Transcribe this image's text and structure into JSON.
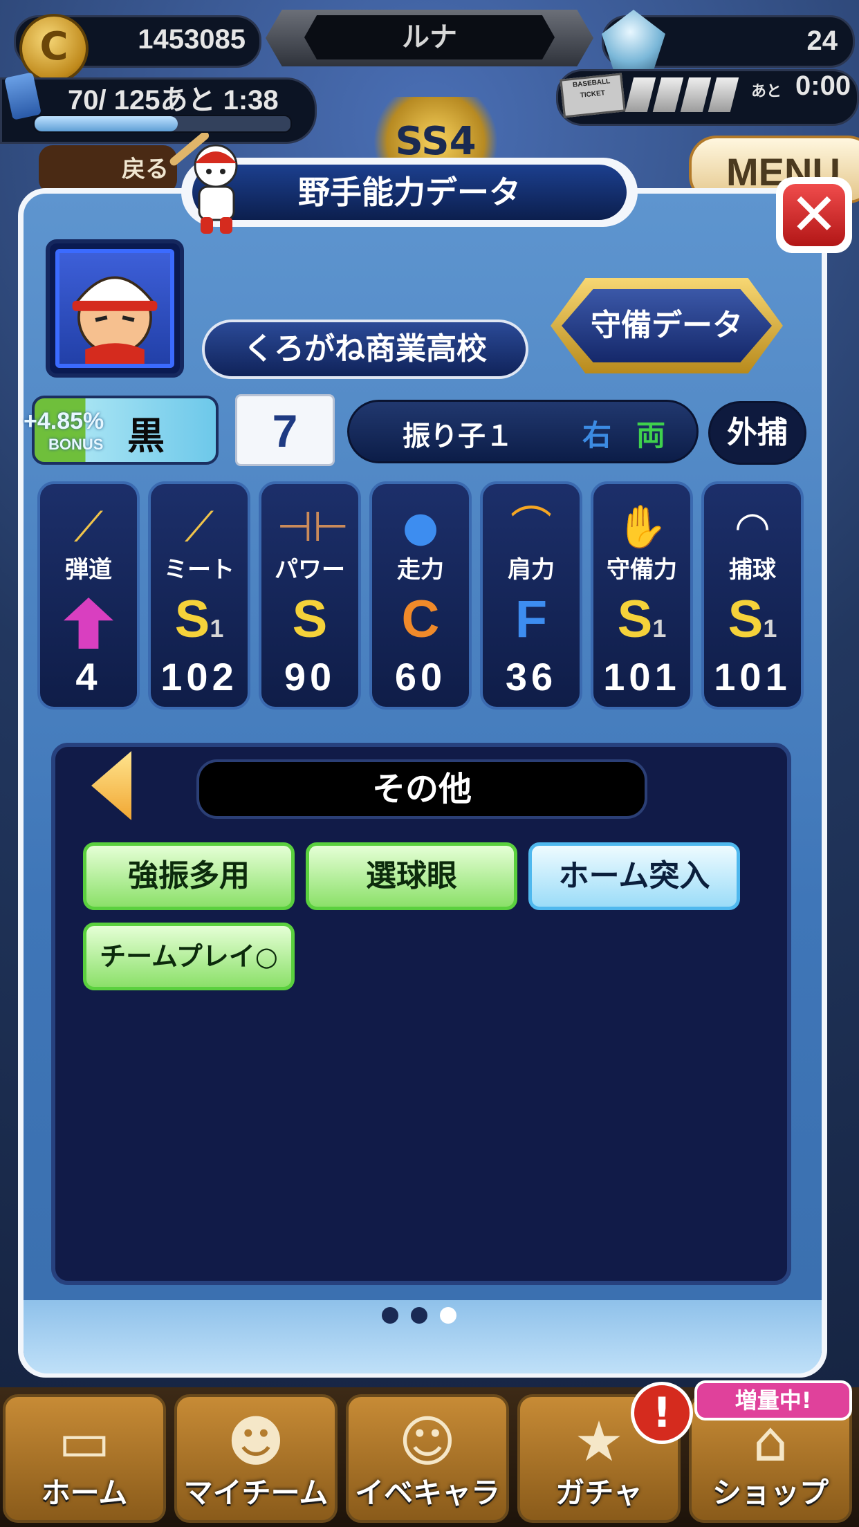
{
  "hud": {
    "coin_symbol": "C",
    "coins": "1453085",
    "player_name": "ルナ",
    "gems": "24",
    "stamina_text": "70/ 125あと  1:38",
    "stamina_fill_fraction": 0.56,
    "ticket_label": "BASEBALL TICKET",
    "ticket_ato": "あと",
    "ticket_time": "0:00",
    "rank_badge": "SS4",
    "back_label": "戻る",
    "menu_label": "MENU"
  },
  "panel": {
    "title": "野手能力データ",
    "close_symbol": "✕",
    "school": "くろがね商業高校",
    "defense_button": "守備データ",
    "bonus_percent": "+4.85%",
    "bonus_label": "BONUS",
    "aptitude": "黒",
    "uniform_number": "7",
    "batting_form": "振り子１",
    "bats": "右",
    "throws": "両",
    "position": "外捕"
  },
  "stats": [
    {
      "label": "弾道",
      "grade": "",
      "grade_sub": "",
      "value": "4",
      "icon": "trajectory-bat-icon",
      "color": "#d93fc0"
    },
    {
      "label": "ミート",
      "grade": "S",
      "grade_sub": "1",
      "value": "102",
      "icon": "bat-icon",
      "color": "#f5d23a"
    },
    {
      "label": "パワー",
      "grade": "S",
      "grade_sub": "",
      "value": "90",
      "icon": "dumbbell-icon",
      "color": "#f5d23a"
    },
    {
      "label": "走力",
      "grade": "C",
      "grade_sub": "",
      "value": "60",
      "icon": "running-ball-icon",
      "color": "#f08a2a"
    },
    {
      "label": "肩力",
      "grade": "F",
      "grade_sub": "",
      "value": "36",
      "icon": "throw-arc-icon",
      "color": "#3d8df0"
    },
    {
      "label": "守備力",
      "grade": "S",
      "grade_sub": "1",
      "value": "101",
      "icon": "glove-icon",
      "color": "#f5d23a"
    },
    {
      "label": "捕球",
      "grade": "S",
      "grade_sub": "1",
      "value": "101",
      "icon": "catch-ball-icon",
      "color": "#f5d23a"
    }
  ],
  "skills": {
    "header": "その他",
    "items": [
      {
        "label": "強振多用",
        "style": "green"
      },
      {
        "label": "選球眼",
        "style": "green"
      },
      {
        "label": "ホーム突入",
        "style": "blue"
      },
      {
        "label": "チームプレイ○",
        "style": "green"
      }
    ],
    "page_count": 3,
    "active_page": 3
  },
  "bottom_nav": {
    "items": [
      {
        "label": "ホーム",
        "icon": "book-icon"
      },
      {
        "label": "マイチーム",
        "icon": "team-icon"
      },
      {
        "label": "イベキャラ",
        "icon": "character-icon"
      },
      {
        "label": "ガチャ",
        "icon": "gacha-icon"
      },
      {
        "label": "ショップ",
        "icon": "shop-icon"
      }
    ],
    "notify_symbol": "!",
    "promo_label": "増量中!"
  }
}
